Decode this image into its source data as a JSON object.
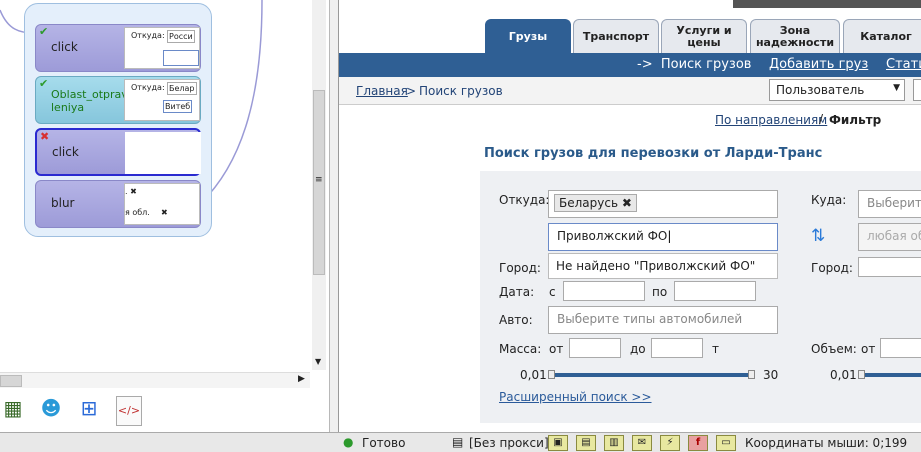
{
  "left_panel": {
    "steps": [
      {
        "label": "click",
        "status": "ok",
        "thumb_label": "Откуда:",
        "thumb_value": "Росси"
      },
      {
        "label": "Oblast_otprav\nleniya",
        "status": "ok",
        "thumb_label": "Откуда:",
        "thumb_value": "Белар",
        "thumb_value2": "Витеб"
      },
      {
        "label": "click",
        "status": "error"
      },
      {
        "label": "blur",
        "status": "none",
        "thumb_value": "я обл."
      }
    ],
    "tools": [
      {
        "icon": "board-icon"
      },
      {
        "icon": "bug-icon"
      },
      {
        "icon": "tree-icon"
      },
      {
        "icon": "code-file-icon"
      }
    ]
  },
  "browser": {
    "tabs": [
      "Грузы",
      "Транспорт",
      "Услуги и цены",
      "Зона надежности",
      "Каталог"
    ],
    "nav": {
      "current": "->  Поиск грузов",
      "add": "Добавить груз",
      "stats": "Стати"
    },
    "breadcrumb": {
      "home": "Главная",
      "sep": ">",
      "current": "Поиск грузов"
    },
    "user_select": "Пользователь",
    "search_mode": {
      "by_direction": "По направлениям",
      "sep": "/",
      "filter": "Фильтр"
    },
    "heading": "Поиск грузов для перевозки от Ларди-Транс",
    "form": {
      "from_label": "Откуда:",
      "from_tag": "Беларусь",
      "from_input": "Приволжский ФО",
      "dropdown_item": "Не найдено \"Приволжский ФО\"",
      "to_label": "Куда:",
      "to_placeholder": "Выберите",
      "to_placeholder2": "любая об",
      "city_label": "Город:",
      "city_label2": "Город:",
      "date_label": "Дата:",
      "date_from": "с",
      "date_to": "по",
      "auto_label": "Авто:",
      "auto_placeholder": "Выберите типы автомобилей",
      "mass_label": "Масса:",
      "mass_from": "от",
      "mass_to": "до",
      "mass_unit": "т",
      "mass_min": "0,01",
      "mass_max": "30",
      "volume_label": "Объем:",
      "volume_from": "от",
      "volume_min": "0,01",
      "advanced": "Расширенный поиск >>"
    }
  },
  "status_bar": {
    "ready": "Готово",
    "proxy": "[Без прокси]",
    "coords": "Координаты мыши: 0;199"
  }
}
